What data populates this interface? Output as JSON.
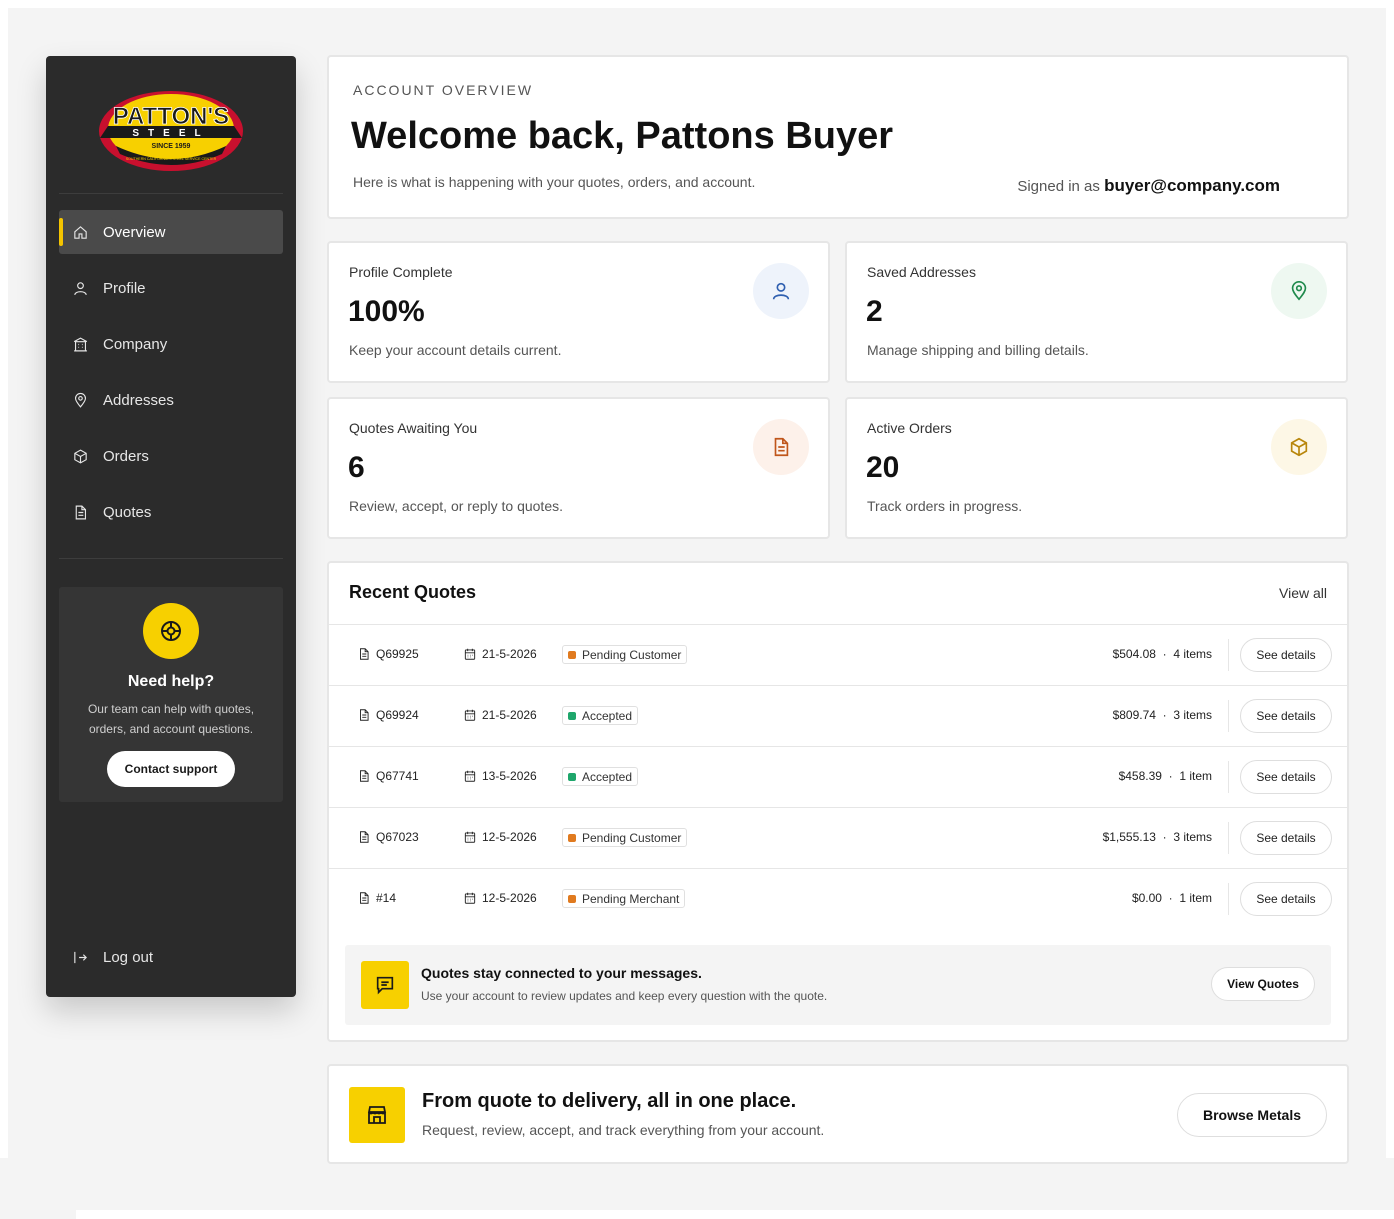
{
  "brand": {
    "logo_main": "PATTON'S",
    "logo_sub": "STEEL",
    "logo_since": "SINCE 1959",
    "logo_tagline": "SOUTHERN CALIFORNIA'S STEEL SERVICE CENTER"
  },
  "sidebar": {
    "items": [
      {
        "label": "Overview",
        "icon": "home-icon",
        "active": true
      },
      {
        "label": "Profile",
        "icon": "user-icon",
        "active": false
      },
      {
        "label": "Company",
        "icon": "building-icon",
        "active": false
      },
      {
        "label": "Addresses",
        "icon": "map-pin-icon",
        "active": false
      },
      {
        "label": "Orders",
        "icon": "box-icon",
        "active": false
      },
      {
        "label": "Quotes",
        "icon": "document-icon",
        "active": false
      }
    ],
    "help": {
      "title": "Need help?",
      "text": "Our team can help with quotes, orders, and account questions.",
      "button": "Contact support"
    },
    "logout": "Log out"
  },
  "overview": {
    "eyebrow": "ACCOUNT OVERVIEW",
    "title": "Welcome back, Pattons Buyer",
    "subtitle": "Here is what is happening with your quotes, orders, and account.",
    "signed_prefix": "Signed in as",
    "email": "buyer@company.com"
  },
  "stats": [
    {
      "label": "Profile Complete",
      "value": "100%",
      "desc": "Keep your account details current.",
      "icon": "user-icon",
      "color": "#2f5fb0",
      "bg": "#eef3fb"
    },
    {
      "label": "Saved Addresses",
      "value": "2",
      "desc": "Manage shipping and billing details.",
      "icon": "map-pin-icon",
      "color": "#1f8a4c",
      "bg": "#eef8f1"
    },
    {
      "label": "Quotes Awaiting You",
      "value": "6",
      "desc": "Review, accept, or reply to quotes.",
      "icon": "document-icon",
      "color": "#c0561b",
      "bg": "#fdf1ea"
    },
    {
      "label": "Active Orders",
      "value": "20",
      "desc": "Track orders in progress.",
      "icon": "box-icon",
      "color": "#b8860b",
      "bg": "#fdf7e6"
    }
  ],
  "recent_quotes": {
    "title": "Recent Quotes",
    "view_all": "View all",
    "rows": [
      {
        "id": "Q69925",
        "date": "21-5-2026",
        "status": "Pending Customer",
        "status_color": "#e07a1f",
        "amount": "$504.08",
        "items": "4 items",
        "action": "See details"
      },
      {
        "id": "Q69924",
        "date": "21-5-2026",
        "status": "Accepted",
        "status_color": "#1ea66b",
        "amount": "$809.74",
        "items": "3 items",
        "action": "See details"
      },
      {
        "id": "Q67741",
        "date": "13-5-2026",
        "status": "Accepted",
        "status_color": "#1ea66b",
        "amount": "$458.39",
        "items": "1 item",
        "action": "See details"
      },
      {
        "id": "Q67023",
        "date": "12-5-2026",
        "status": "Pending Customer",
        "status_color": "#e07a1f",
        "amount": "$1,555.13",
        "items": "3 items",
        "action": "See details"
      },
      {
        "id": "#14",
        "date": "12-5-2026",
        "status": "Pending Merchant",
        "status_color": "#e07a1f",
        "amount": "$0.00",
        "items": "1 item",
        "action": "See details"
      }
    ],
    "banner": {
      "title": "Quotes stay connected to your messages.",
      "text": "Use your account to review updates and keep every question with the quote.",
      "button": "View Quotes"
    }
  },
  "promo": {
    "title": "From quote to delivery, all in one place.",
    "text": "Request, review, accept, and track everything from your account.",
    "button": "Browse Metals"
  },
  "colors": {
    "accent": "#f7d000",
    "sidebar_bg": "#2b2b2b"
  }
}
